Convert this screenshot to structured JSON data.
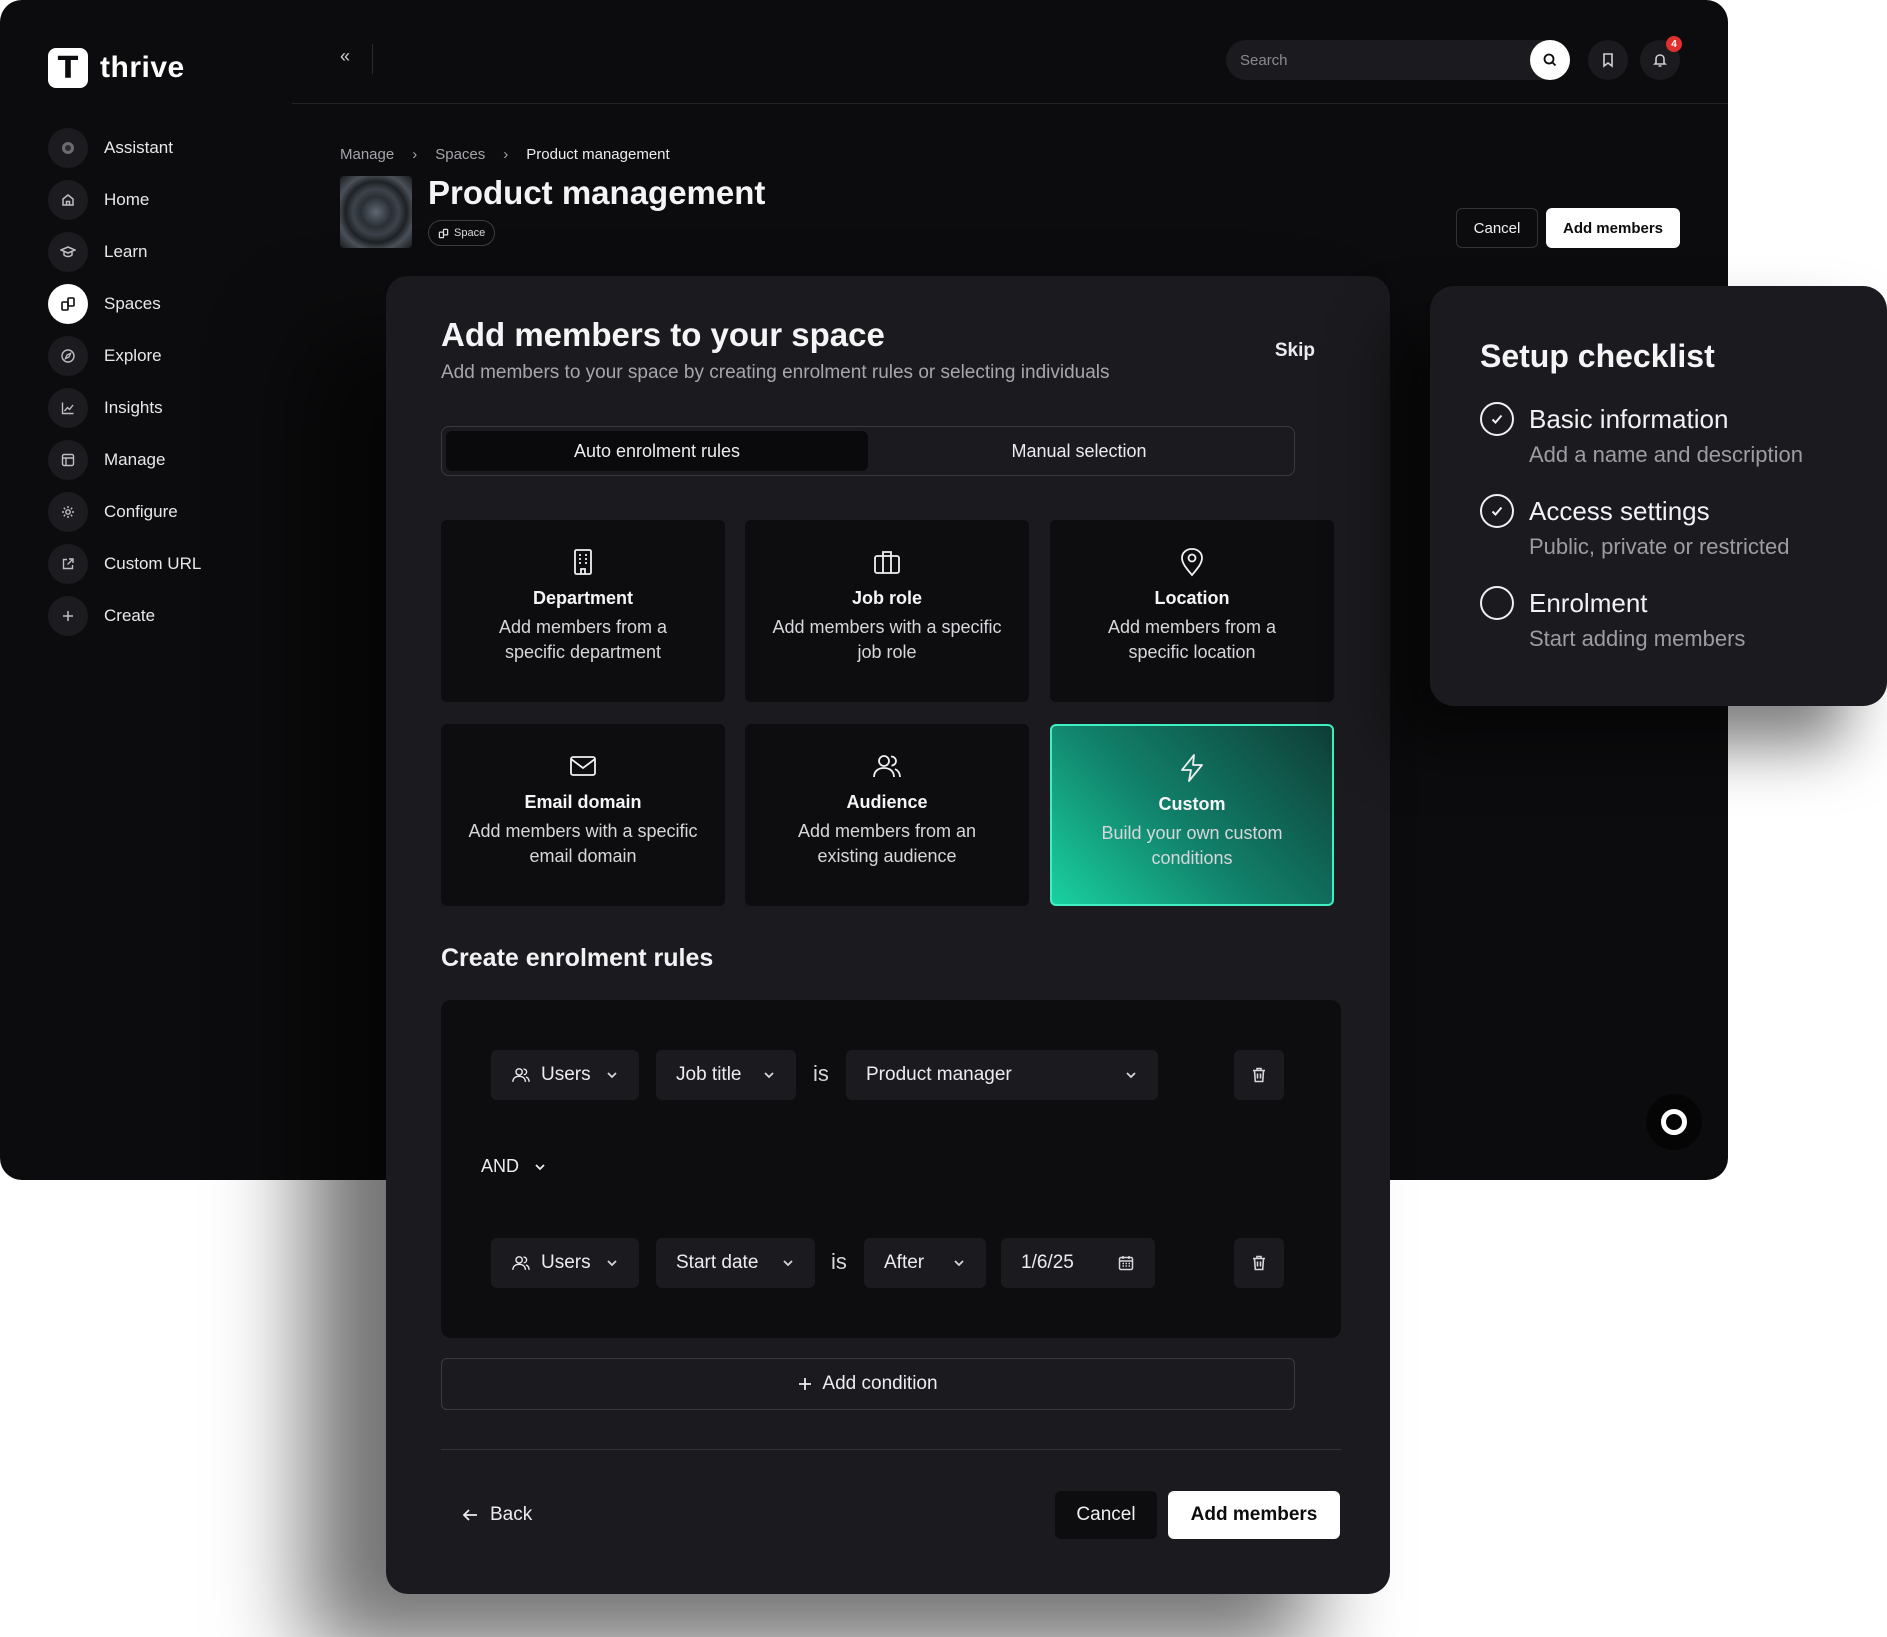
{
  "app": {
    "logo_letter": "T",
    "name": "thrive"
  },
  "sidebar": {
    "items": [
      {
        "label": "Assistant",
        "icon": "assistant-icon"
      },
      {
        "label": "Home",
        "icon": "home-icon"
      },
      {
        "label": "Learn",
        "icon": "learn-icon"
      },
      {
        "label": "Spaces",
        "icon": "spaces-icon",
        "active": true
      },
      {
        "label": "Explore",
        "icon": "compass-icon"
      },
      {
        "label": "Insights",
        "icon": "chart-icon"
      },
      {
        "label": "Manage",
        "icon": "manage-icon"
      },
      {
        "label": "Configure",
        "icon": "gear-icon"
      },
      {
        "label": "Custom URL",
        "icon": "external-link-icon"
      },
      {
        "label": "Create",
        "icon": "plus-icon"
      }
    ]
  },
  "topbar": {
    "search_placeholder": "Search",
    "notification_count": "4"
  },
  "breadcrumb": [
    "Manage",
    "Spaces",
    "Product management"
  ],
  "page": {
    "title": "Product management",
    "chip": "Space",
    "cancel_label": "Cancel",
    "add_label": "Add members"
  },
  "modal": {
    "title": "Add members to your space",
    "subtitle": "Add members to your space by creating enrolment rules or selecting individuals",
    "skip_label": "Skip",
    "tabs": [
      "Auto enrolment rules",
      "Manual selection"
    ],
    "cards": [
      {
        "title": "Department",
        "desc": "Add members from a specific department",
        "icon": "building-icon"
      },
      {
        "title": "Job role",
        "desc": "Add members with a specific job role",
        "icon": "briefcase-icon"
      },
      {
        "title": "Location",
        "desc": "Add members from a specific location",
        "icon": "location-pin-icon"
      },
      {
        "title": "Email domain",
        "desc": "Add members with a specific email domain",
        "icon": "mail-icon"
      },
      {
        "title": "Audience",
        "desc": "Add members from an existing audience",
        "icon": "users-icon"
      },
      {
        "title": "Custom",
        "desc": "Build your own custom conditions",
        "icon": "lightning-icon",
        "selected": true
      }
    ],
    "rules_heading": "Create enrolment rules",
    "rule1": {
      "subject": "Users",
      "field": "Job title",
      "operator": "is",
      "value": "Product manager"
    },
    "connector": "AND",
    "rule2": {
      "subject": "Users",
      "field": "Start date",
      "operator": "is",
      "comparison": "After",
      "date": "1/6/25"
    },
    "add_condition_label": "Add condition",
    "back_label": "Back",
    "cancel_label": "Cancel",
    "add_label": "Add members"
  },
  "checklist": {
    "title": "Setup checklist",
    "items": [
      {
        "name": "Basic information",
        "desc": "Add a name and description",
        "done": true
      },
      {
        "name": "Access settings",
        "desc": "Public, private or restricted",
        "done": true
      },
      {
        "name": "Enrolment",
        "desc": "Start adding members",
        "done": false
      }
    ]
  },
  "colors": {
    "accent": "#19d1a0",
    "background": "#0c0c0e",
    "panel": "#1b1b1f",
    "badge": "#e0302d"
  }
}
